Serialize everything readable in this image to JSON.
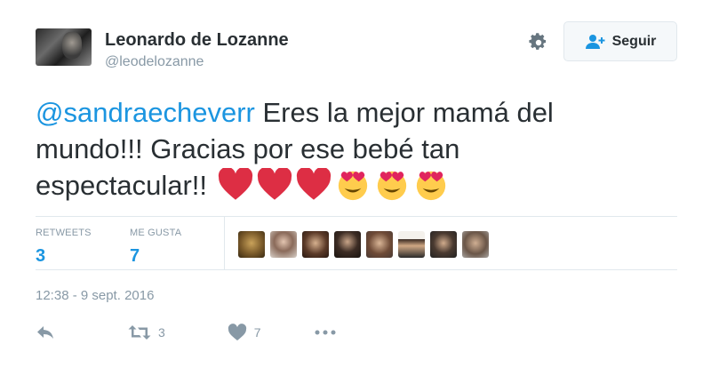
{
  "author": {
    "name": "Leonardo de Lozanne",
    "handle": "@leodelozanne"
  },
  "follow_button": {
    "label": "Seguir"
  },
  "tweet": {
    "mention": "@sandraecheverr",
    "text": " Eres la mejor mamá del mundo!!! Gracias por ese bebé tan espectacular!! "
  },
  "stats": {
    "retweets_label": "RETWEETS",
    "retweets_value": "3",
    "likes_label": "ME GUSTA",
    "likes_value": "7"
  },
  "timestamp": "12:38 - 9 sept. 2016",
  "actions": {
    "retweet_count": "3",
    "like_count": "7"
  },
  "colors": {
    "accent": "#1b95e0",
    "muted": "#8899a6",
    "heart": "#e0245e"
  },
  "icons": [
    "gear-icon",
    "follow-user-icon",
    "heart-emoji",
    "heart-eyes-emoji",
    "reply-icon",
    "retweet-icon",
    "like-icon",
    "more-icon"
  ]
}
